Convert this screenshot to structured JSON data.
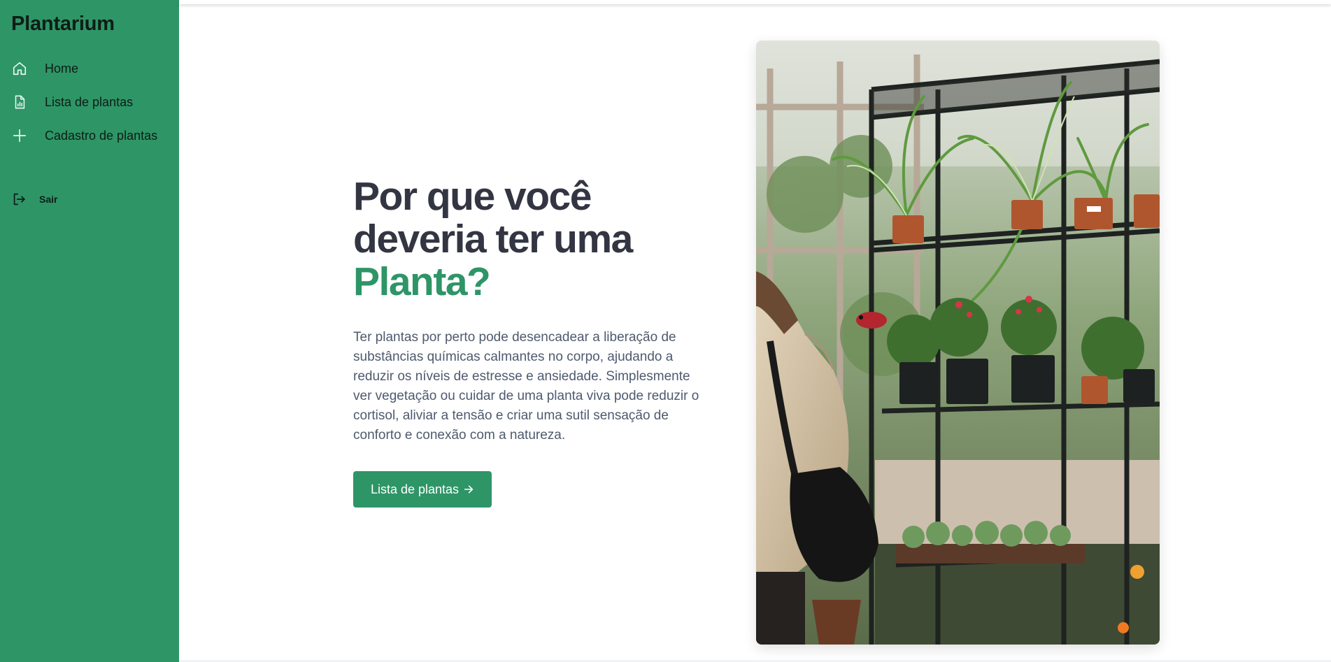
{
  "sidebar": {
    "brand": "Plantarium",
    "items": [
      {
        "label": "Home",
        "icon": "home-icon"
      },
      {
        "label": "Lista de plantas",
        "icon": "file-chart-icon"
      },
      {
        "label": "Cadastro de plantas",
        "icon": "plus-icon"
      }
    ],
    "logout": {
      "label": "Sair",
      "icon": "logout-icon"
    }
  },
  "hero": {
    "title_line1": "Por que você",
    "title_line2": "deveria ter uma",
    "title_accent": "Planta?",
    "body": "Ter plantas por perto pode desencadear a liberação de substâncias químicas calmantes no corpo, ajudando a reduzir os níveis de estresse e ansiedade. Simplesmente ver vegetação ou cuidar de uma planta viva pode reduzir o cortisol, aliviar a tensão e criar uma sutil sensação de conforto e conexão com a natureza.",
    "cta_label": "Lista de plantas",
    "cta_icon": "arrow-right-icon"
  },
  "colors": {
    "accent": "#2e9567",
    "heading": "#333642",
    "body_text": "#4e5a6e",
    "sidebar_text": "#0e1d16"
  }
}
